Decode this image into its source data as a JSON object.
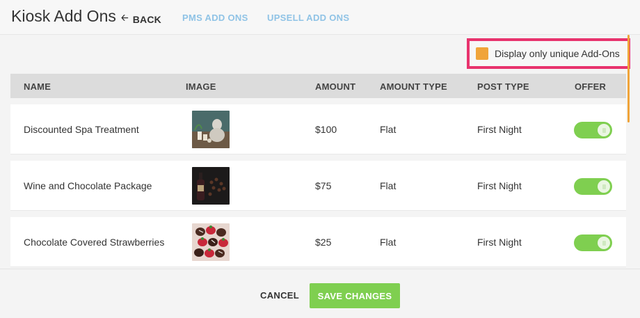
{
  "header": {
    "title": "Kiosk Add Ons",
    "back_label": "BACK",
    "nav": [
      "PMS ADD ONS",
      "UPSELL ADD ONS"
    ]
  },
  "filter": {
    "label": "Display only unique Add-Ons",
    "checkbox_color": "#f0a43a",
    "highlight_color": "#e8336d"
  },
  "table": {
    "columns": [
      "NAME",
      "IMAGE",
      "AMOUNT",
      "AMOUNT TYPE",
      "POST TYPE",
      "OFFER"
    ],
    "rows": [
      {
        "name": "Discounted Spa Treatment",
        "image_icon": "spa-image",
        "amount": "$100",
        "amount_type": "Flat",
        "post_type": "First Night",
        "offer": true
      },
      {
        "name": "Wine and Chocolate Package",
        "image_icon": "wine-image",
        "amount": "$75",
        "amount_type": "Flat",
        "post_type": "First Night",
        "offer": true
      },
      {
        "name": "Chocolate Covered Strawberries",
        "image_icon": "strawberries-image",
        "amount": "$25",
        "amount_type": "Flat",
        "post_type": "First Night",
        "offer": true
      }
    ]
  },
  "footer": {
    "cancel_label": "CANCEL",
    "save_label": "SAVE CHANGES"
  },
  "colors": {
    "accent_green": "#7fcf50",
    "nav_blue": "#8fc3e6"
  }
}
